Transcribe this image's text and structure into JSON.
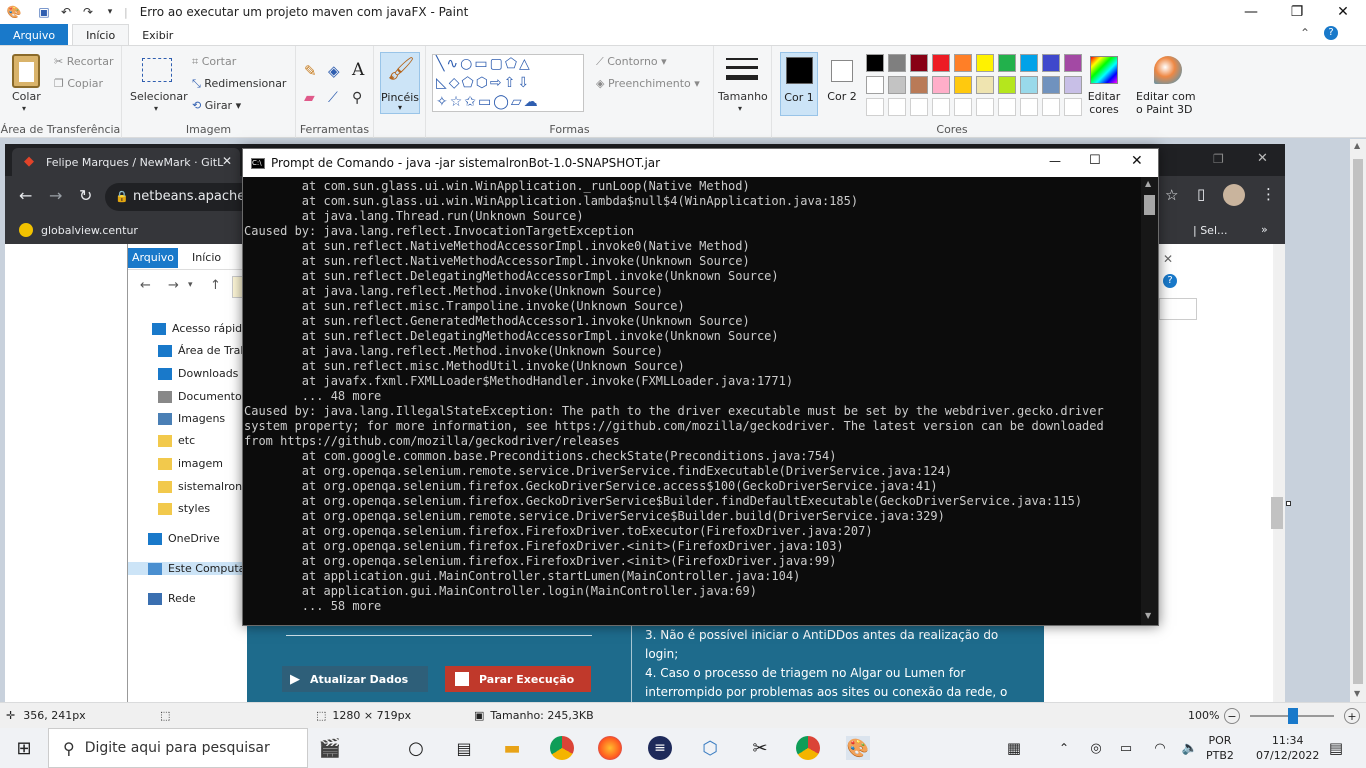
{
  "window": {
    "title": "Erro ao executar um projeto maven com javaFX - Paint"
  },
  "ribbon_tabs": [
    "Arquivo",
    "Início",
    "Exibir"
  ],
  "clipboard": {
    "paste": "Colar",
    "cut": "Recortar",
    "copy": "Copiar",
    "label": "Área de Transferência"
  },
  "image": {
    "select": "Selecionar",
    "crop": "Cortar",
    "resize": "Redimensionar",
    "rotate": "Girar",
    "label": "Imagem"
  },
  "tools": {
    "label": "Ferramentas"
  },
  "brushes": {
    "label": "Pincéis"
  },
  "shapes": {
    "outline": "Contorno",
    "fill": "Preenchimento",
    "label": "Formas"
  },
  "size": {
    "label": "Tamanho"
  },
  "colors": {
    "color1": "Cor 1",
    "color2": "Cor 2",
    "edit": "Editar cores",
    "paint3d": "Editar com o Paint 3D",
    "label": "Cores",
    "palette": [
      "#000000",
      "#7f7f7f",
      "#880015",
      "#ed1c24",
      "#ff7f27",
      "#fff200",
      "#22b14c",
      "#00a2e8",
      "#3f48cc",
      "#a349a4",
      "#ffffff",
      "#c3c3c3",
      "#b97a57",
      "#ffaec9",
      "#ffc90e",
      "#efe4b0",
      "#b5e61d",
      "#99d9ea",
      "#7092be",
      "#c8bfe7"
    ]
  },
  "chrome": {
    "tab": "Felipe Marques / NewMark · GitL",
    "url": "netbeans.apache.c",
    "bookmark": "globalview.centur",
    "bookmark_right": "| Sel..."
  },
  "explorer": {
    "tabs": [
      "Arquivo",
      "Início"
    ],
    "nav": [
      "Acesso rápido",
      "Área de Traba",
      "Downloads",
      "Documentos",
      "Imagens",
      "etc",
      "imagem",
      "sistemalronBo",
      "styles",
      "OneDrive",
      "Este Computad",
      "Rede"
    ]
  },
  "app": {
    "update_btn": "Atualizar Dados",
    "stop_btn": "Parar Execução",
    "notes": [
      "3. Não é possível iniciar o AntiDDos antes da realização do",
      "login;",
      "4. Caso o processo de triagem no Algar ou Lumen for",
      "interrompido por problemas aos sites ou conexão da rede, o"
    ]
  },
  "cmd": {
    "title": "Prompt de Comando - java  -jar sistemalronBot-1.0-SNAPSHOT.jar",
    "lines": [
      "        at com.sun.glass.ui.win.WinApplication._runLoop(Native Method)",
      "        at com.sun.glass.ui.win.WinApplication.lambda$null$4(WinApplication.java:185)",
      "        at java.lang.Thread.run(Unknown Source)",
      "Caused by: java.lang.reflect.InvocationTargetException",
      "        at sun.reflect.NativeMethodAccessorImpl.invoke0(Native Method)",
      "        at sun.reflect.NativeMethodAccessorImpl.invoke(Unknown Source)",
      "        at sun.reflect.DelegatingMethodAccessorImpl.invoke(Unknown Source)",
      "        at java.lang.reflect.Method.invoke(Unknown Source)",
      "        at sun.reflect.misc.Trampoline.invoke(Unknown Source)",
      "        at sun.reflect.GeneratedMethodAccessor1.invoke(Unknown Source)",
      "        at sun.reflect.DelegatingMethodAccessorImpl.invoke(Unknown Source)",
      "        at java.lang.reflect.Method.invoke(Unknown Source)",
      "        at sun.reflect.misc.MethodUtil.invoke(Unknown Source)",
      "        at javafx.fxml.FXMLLoader$MethodHandler.invoke(FXMLLoader.java:1771)",
      "        ... 48 more",
      "Caused by: java.lang.IllegalStateException: The path to the driver executable must be set by the webdriver.gecko.driver",
      "system property; for more information, see https://github.com/mozilla/geckodriver. The latest version can be downloaded",
      "from https://github.com/mozilla/geckodriver/releases",
      "        at com.google.common.base.Preconditions.checkState(Preconditions.java:754)",
      "        at org.openqa.selenium.remote.service.DriverService.findExecutable(DriverService.java:124)",
      "        at org.openqa.selenium.firefox.GeckoDriverService.access$100(GeckoDriverService.java:41)",
      "        at org.openqa.selenium.firefox.GeckoDriverService$Builder.findDefaultExecutable(GeckoDriverService.java:115)",
      "        at org.openqa.selenium.remote.service.DriverService$Builder.build(DriverService.java:329)",
      "        at org.openqa.selenium.firefox.FirefoxDriver.toExecutor(FirefoxDriver.java:207)",
      "        at org.openqa.selenium.firefox.FirefoxDriver.<init>(FirefoxDriver.java:103)",
      "        at org.openqa.selenium.firefox.FirefoxDriver.<init>(FirefoxDriver.java:99)",
      "        at application.gui.MainController.startLumen(MainController.java:104)",
      "        at application.gui.MainController.login(MainController.java:69)",
      "        ... 58 more"
    ]
  },
  "status": {
    "cursor": "356, 241px",
    "dims": "1280 × 719px",
    "filesize": "Tamanho: 245,3KB",
    "zoom": "100%"
  },
  "taskbar": {
    "search": "Digite aqui para pesquisar",
    "lang1": "POR",
    "lang2": "PTB2",
    "time": "11:34",
    "date": "07/12/2022"
  }
}
